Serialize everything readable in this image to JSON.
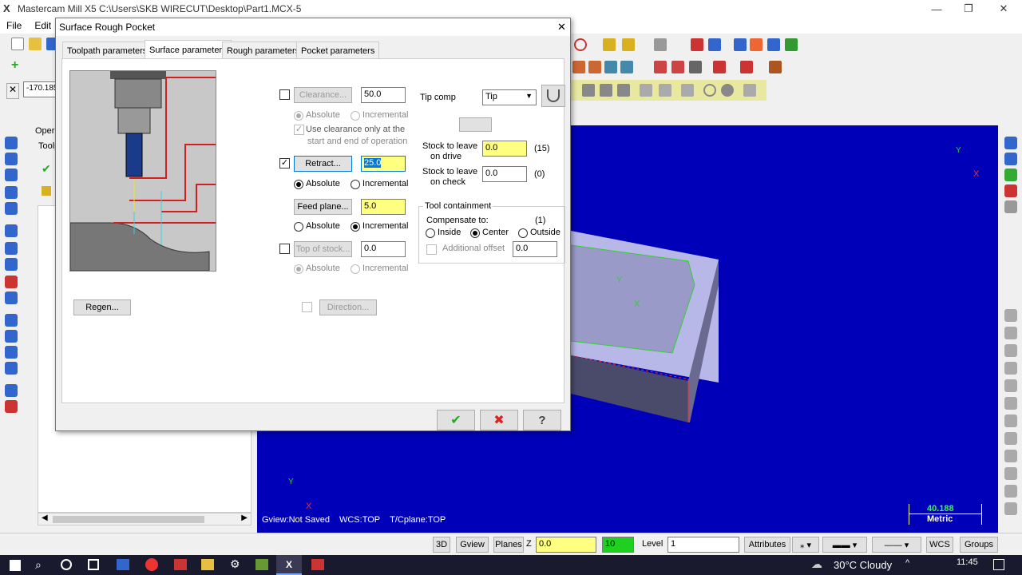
{
  "app": {
    "title": "Mastercam Mill X5  C:\\Users\\SKB WIRECUT\\Desktop\\Part1.MCX-5",
    "min": "—",
    "max": "❐",
    "close": "✕"
  },
  "menu": [
    "File",
    "Edit"
  ],
  "coord_field": "-170.185",
  "left_pane": {
    "tab1": "Opera",
    "tab2": "Toolp"
  },
  "dialog": {
    "title": "Surface Rough Pocket",
    "close": "✕",
    "tabs": [
      "Toolpath parameters",
      "Surface parameters",
      "Rough parameters",
      "Pocket parameters"
    ],
    "clearance": {
      "label": "Clearance...",
      "value": "50.0",
      "absolute": "Absolute",
      "incremental": "Incremental",
      "use_clearance": "Use clearance only at the",
      "use_clearance2": "start and end of operation"
    },
    "retract": {
      "label": "Retract...",
      "value": "25.0",
      "absolute": "Absolute",
      "incremental": "Incremental",
      "checked": "✓"
    },
    "feed": {
      "label": "Feed plane...",
      "value": "5.0",
      "absolute": "Absolute",
      "incremental": "Incremental"
    },
    "top_stock": {
      "label": "Top of stock...",
      "value": "0.0",
      "absolute": "Absolute",
      "incremental": "Incremental"
    },
    "tip_comp": {
      "label": "Tip comp",
      "value": "Tip"
    },
    "stock_drive": {
      "label1": "Stock to leave",
      "label2": "on drive",
      "value": "0.0",
      "count": "(15)"
    },
    "stock_check": {
      "label1": "Stock to leave",
      "label2": "on check",
      "value": "0.0",
      "count": "(0)"
    },
    "tool_containment": {
      "title": "Tool containment",
      "compensate": "Compensate to:",
      "count": "(1)",
      "inside": "Inside",
      "center": "Center",
      "outside": "Outside",
      "additional": "Additional offset",
      "add_value": "0.0"
    },
    "regen": "Regen...",
    "direction": "Direction...",
    "ok": "✔",
    "cancel": "✖",
    "help": "?"
  },
  "viewport": {
    "gview": "Gview:Not Saved",
    "wcs": "WCS:TOP",
    "tcplane": "T/Cplane:TOP",
    "scale_value": "40.188",
    "scale_unit": "Metric",
    "axis_x": "X",
    "axis_y": "Y"
  },
  "statusbar": {
    "btn_3d": "3D",
    "gview": "Gview",
    "planes": "Planes",
    "z": "Z",
    "z_value": "0.0",
    "color_value": "10",
    "level": "Level",
    "level_value": "1",
    "attributes": "Attributes",
    "wcs": "WCS",
    "groups": "Groups"
  },
  "taskbar": {
    "weather": "30°C  Cloudy",
    "time": "11:45"
  },
  "colors": {
    "viewport": "#0000b8",
    "part": "#b8b8e8",
    "highlight": "#ffff80"
  }
}
